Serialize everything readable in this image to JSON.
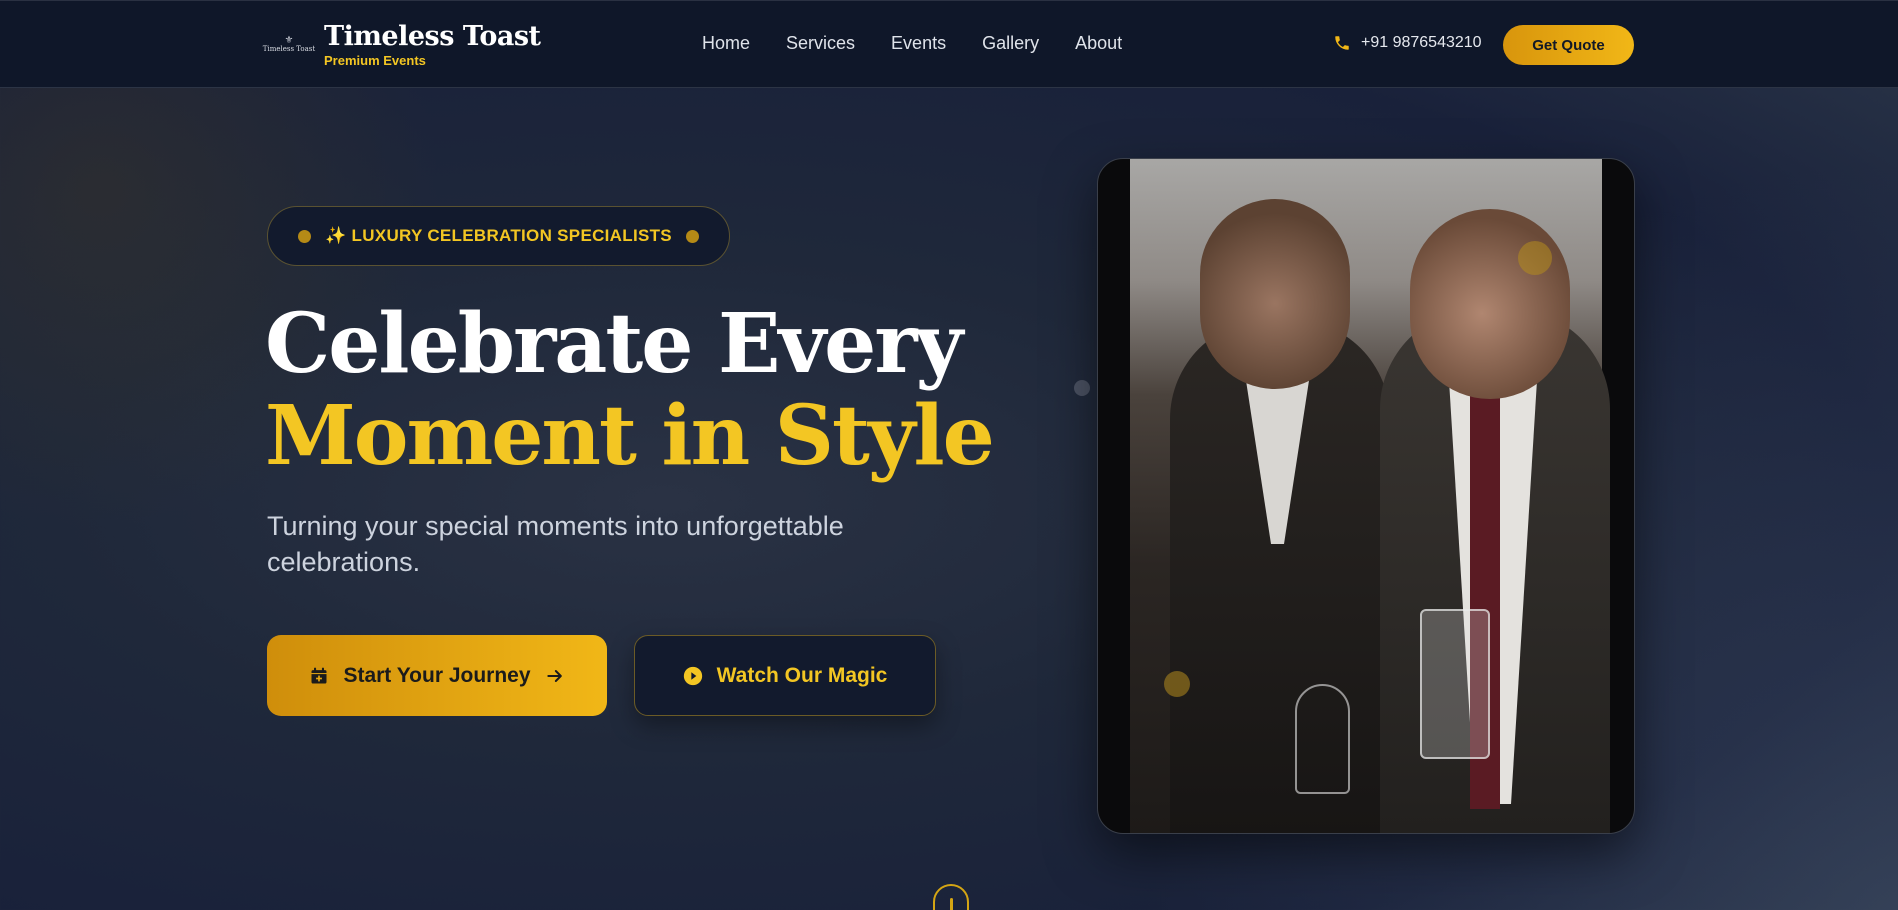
{
  "brand": {
    "logo_text": "Timeless Toast",
    "name": "Timeless Toast",
    "tagline": "Premium Events"
  },
  "nav": {
    "items": [
      {
        "label": "Home"
      },
      {
        "label": "Services"
      },
      {
        "label": "Events"
      },
      {
        "label": "Gallery"
      },
      {
        "label": "About"
      }
    ]
  },
  "header": {
    "phone": "+91 9876543210",
    "quote_label": "Get Quote"
  },
  "hero": {
    "badge": "✨ LUXURY CELEBRATION SPECIALISTS",
    "title_line1": "Celebrate Every",
    "title_line2": "Moment in Style",
    "subtitle": "Turning your special moments into unforgettable celebrations.",
    "primary_cta": "Start Your Journey",
    "secondary_cta": "Watch Our Magic"
  },
  "colors": {
    "accent": "#f3c623",
    "accent_dark": "#d8950c",
    "header_bg": "#0f1729",
    "page_bg": "#1c2436"
  },
  "icons": {
    "phone": "phone-icon",
    "calendar": "calendar-plus-icon",
    "arrow": "arrow-right-icon",
    "play": "play-circle-icon",
    "scroll": "scroll-mouse-icon"
  }
}
